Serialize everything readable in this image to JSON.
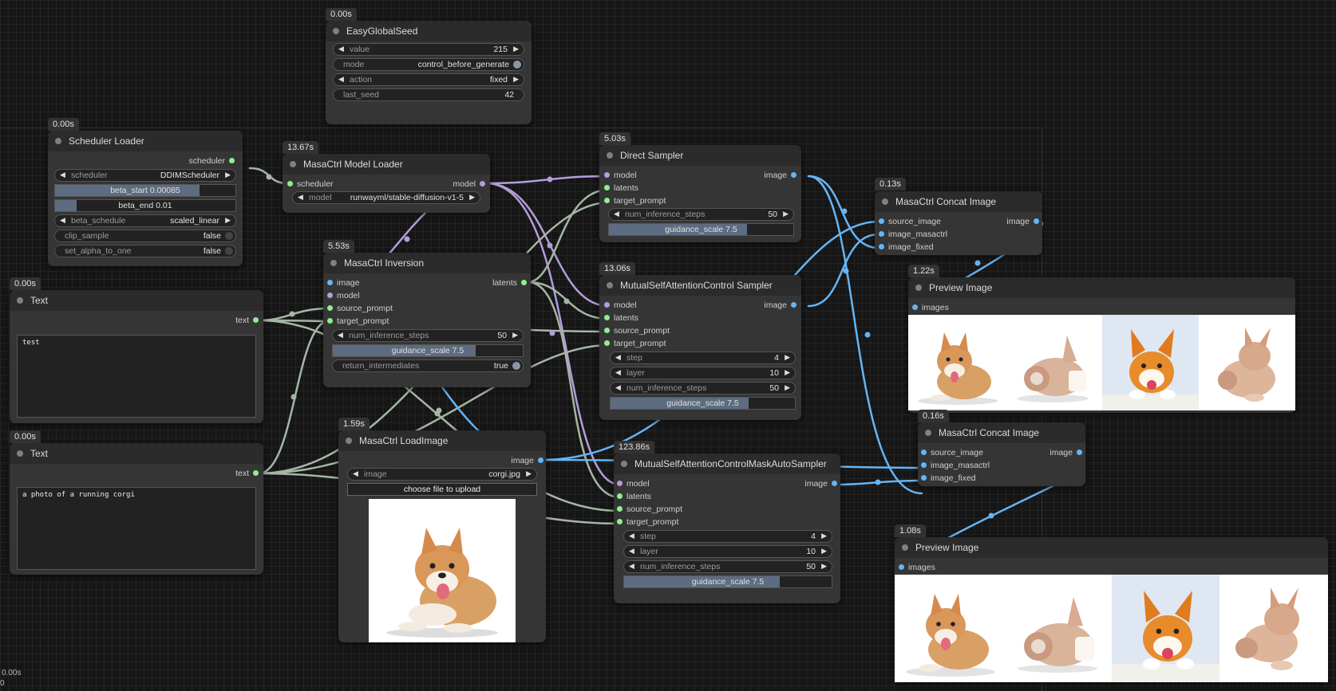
{
  "colors": {
    "model": "#b39ddb",
    "latents": "#90ee90",
    "scheduler": "#90ee90",
    "image": "#64b5f6",
    "text": "#90ee90",
    "wire_green": "#a5b7a5",
    "wire_purple": "#b39ddb",
    "wire_blue": "#64b5f6"
  },
  "easy_global_seed": {
    "time": "0.00s",
    "title": "EasyGlobalSeed",
    "value_label": "value",
    "value": "215",
    "mode_label": "mode",
    "mode": "control_before_generate",
    "action_label": "action",
    "action": "fixed",
    "last_seed_label": "last_seed",
    "last_seed": "42"
  },
  "scheduler_loader": {
    "time": "0.00s",
    "title": "Scheduler Loader",
    "out": "scheduler",
    "scheduler_label": "scheduler",
    "scheduler": "DDIMScheduler",
    "beta_start": "beta_start  0.00085",
    "beta_start_fill": 0.8,
    "beta_end": "beta_end  0.01",
    "beta_end_fill": 0.12,
    "beta_schedule_label": "beta_schedule",
    "beta_schedule": "scaled_linear",
    "clip_sample_label": "clip_sample",
    "clip_sample": "false",
    "set_alpha_label": "set_alpha_to_one",
    "set_alpha": "false"
  },
  "model_loader": {
    "time": "13.67s",
    "title": "MasaCtrl Model Loader",
    "in_scheduler": "scheduler",
    "out": "model",
    "model_label": "model",
    "model": "runwayml/stable-diffusion-v1-5"
  },
  "inversion": {
    "time": "5.53s",
    "title": "MasaCtrl Inversion",
    "in_image": "image",
    "in_model": "model",
    "in_source": "source_prompt",
    "in_target": "target_prompt",
    "out": "latents",
    "steps_label": "num_inference_steps",
    "steps": "50",
    "guidance": "guidance_scale  7.5",
    "guidance_fill": 0.75,
    "return_label": "return_intermediates",
    "return": "true"
  },
  "text1": {
    "time": "0.00s",
    "title": "Text",
    "out": "text",
    "content": "test"
  },
  "text2": {
    "time": "0.00s",
    "title": "Text",
    "out": "text",
    "content": "a photo of a running corgi"
  },
  "load_image": {
    "time": "1.59s",
    "title": "MasaCtrl LoadImage",
    "out": "image",
    "image_label": "image",
    "image": "corgi.jpg",
    "upload": "choose file to upload"
  },
  "direct_sampler": {
    "time": "5.03s",
    "title": "Direct Sampler",
    "in_model": "model",
    "in_latents": "latents",
    "in_target": "target_prompt",
    "out": "image",
    "steps_label": "num_inference_steps",
    "steps": "50",
    "guidance": "guidance_scale  7.5",
    "guidance_fill": 0.75
  },
  "mutual_sampler": {
    "time": "13.06s",
    "title": "MutualSelfAttentionControl Sampler",
    "in_model": "model",
    "in_latents": "latents",
    "in_source": "source_prompt",
    "in_target": "target_prompt",
    "out": "image",
    "step_label": "step",
    "step": "4",
    "layer_label": "layer",
    "layer": "10",
    "steps_label": "num_inference_steps",
    "steps": "50",
    "guidance": "guidance_scale  7.5",
    "guidance_fill": 0.75
  },
  "mask_sampler": {
    "time": "123.86s",
    "title": "MutualSelfAttentionControlMaskAutoSampler",
    "in_model": "model",
    "in_latents": "latents",
    "in_source": "source_prompt",
    "in_target": "target_prompt",
    "out": "image",
    "step_label": "step",
    "step": "4",
    "layer_label": "layer",
    "layer": "10",
    "steps_label": "num_inference_steps",
    "steps": "50",
    "guidance": "guidance_scale  7.5",
    "guidance_fill": 0.75
  },
  "concat1": {
    "time": "0.13s",
    "title": "MasaCtrl Concat Image",
    "in_source": "source_image",
    "in_masactrl": "image_masactrl",
    "in_fixed": "image_fixed",
    "out": "image"
  },
  "concat2": {
    "time": "0.16s",
    "title": "MasaCtrl Concat Image",
    "in_source": "source_image",
    "in_masactrl": "image_masactrl",
    "in_fixed": "image_fixed",
    "out": "image"
  },
  "preview1": {
    "time": "1.22s",
    "title": "Preview Image",
    "in_images": "images"
  },
  "preview2": {
    "time": "1.08s",
    "title": "Preview Image",
    "in_images": "images"
  },
  "footer": {
    "time": "0.00s",
    "count": "0"
  }
}
